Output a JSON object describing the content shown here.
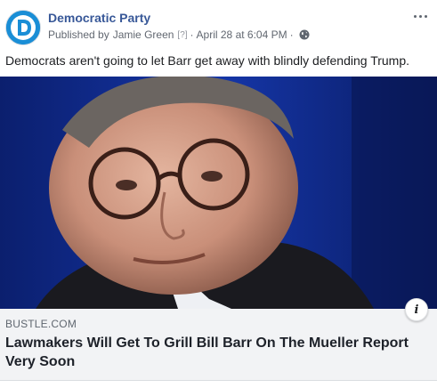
{
  "post": {
    "page_name": "Democratic Party",
    "published_by_prefix": "Published by",
    "publisher": "Jamie Green",
    "publisher_help": "[?]",
    "separator": "·",
    "date": "April 28 at 6:04 PM",
    "audience_icon": "globe-icon",
    "more_icon": "more-options-icon",
    "message": "Democrats aren't going to let Barr get away with blindly defending Trump."
  },
  "link_preview": {
    "domain": "BUSTLE.COM",
    "headline": "Lawmakers Will Get To Grill Bill Barr On The Mueller Report Very Soon",
    "info_icon": "info-icon",
    "info_glyph": "i"
  },
  "colors": {
    "page_name": "#385898",
    "avatar": "#1a8ed6",
    "photo_background": "#0d2a8c",
    "caption_background": "#f2f3f5"
  }
}
